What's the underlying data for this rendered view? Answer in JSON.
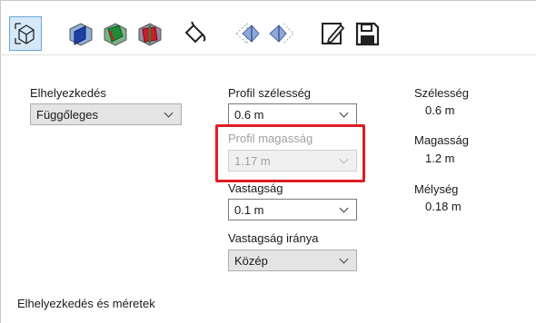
{
  "left": {
    "placement_label": "Elhelyezkedés",
    "placement_value": "Függőleges"
  },
  "middle": {
    "profile_width_label": "Profil szélesség",
    "profile_width_value": "0.6 m",
    "profile_height_label": "Profil magasság",
    "profile_height_value": "1.17 m",
    "thickness_label": "Vastagság",
    "thickness_value": "0.1 m",
    "thickness_dir_label": "Vastagság iránya",
    "thickness_dir_value": "Közép"
  },
  "right": {
    "width_label": "Szélesség",
    "width_value": "0.6 m",
    "height_label": "Magasság",
    "height_value": "1.2 m",
    "depth_label": "Mélység",
    "depth_value": "0.18 m"
  },
  "footer": {
    "caption": "Elhelyezkedés és méretek"
  },
  "toolbar": {
    "icons": [
      "box-view-icon",
      "blue-plane-icon",
      "green-plane-icon",
      "red-plane-icon",
      "paint-bucket-icon",
      "texture-left-icon",
      "texture-right-icon",
      "edit-icon",
      "save-icon"
    ]
  },
  "colors": {
    "highlight": "#e01c24",
    "active_tab": "#d5e8f8"
  }
}
